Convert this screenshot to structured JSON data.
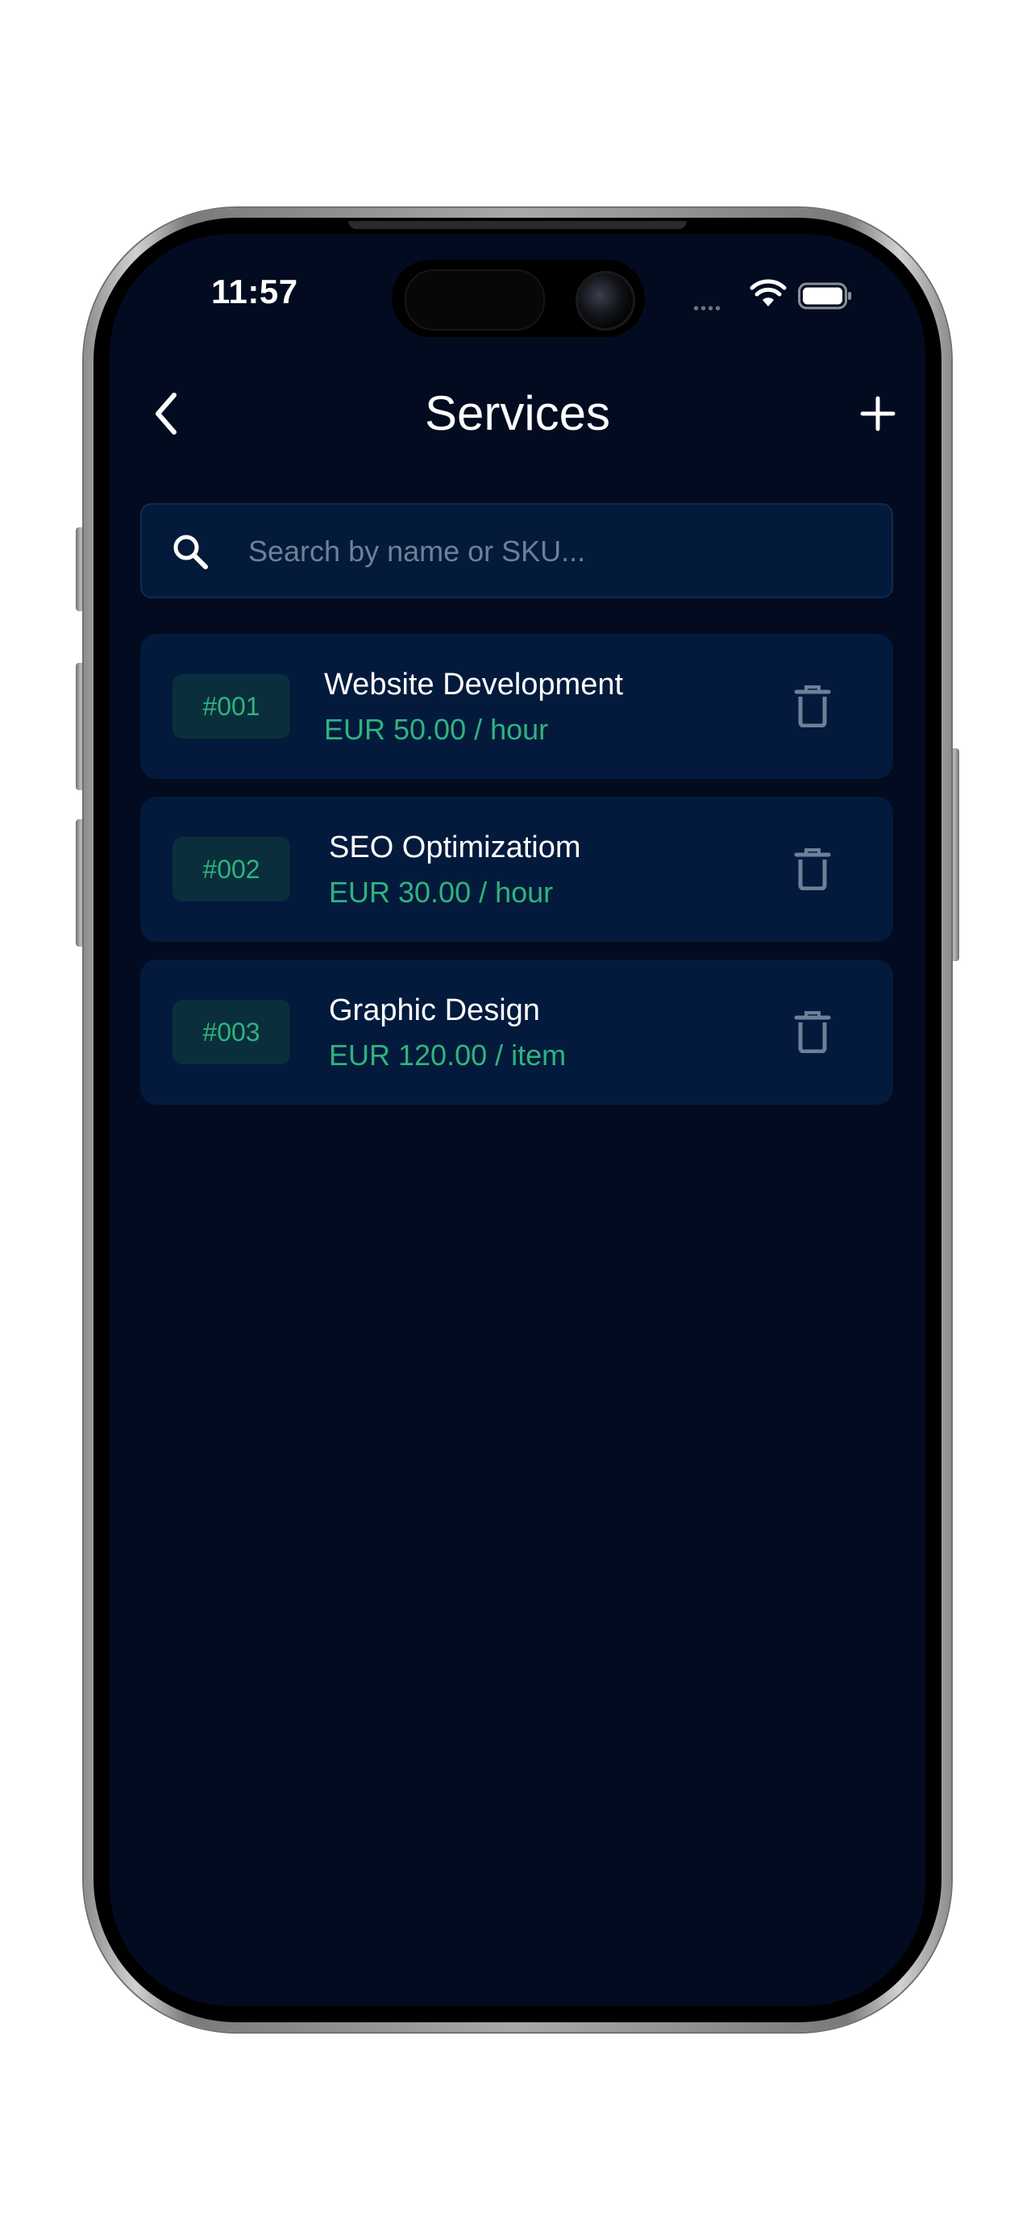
{
  "status_bar": {
    "time": "11:57",
    "dots": "••••",
    "icons": [
      "wifi-icon",
      "battery-icon"
    ]
  },
  "header": {
    "title": "Services",
    "back_icon": "chevron-left-icon",
    "add_icon": "plus-icon"
  },
  "search": {
    "placeholder": "Search by name or SKU...",
    "value": "",
    "icon": "search-icon"
  },
  "services": [
    {
      "sku": "#001",
      "name": "Website Development",
      "price": "EUR 50.00 / hour"
    },
    {
      "sku": "#002",
      "name": "SEO Optimizatiom",
      "price": "EUR 30.00 / hour"
    },
    {
      "sku": "#003",
      "name": "Graphic Design",
      "price": "EUR 120.00 / item"
    }
  ],
  "colors": {
    "background": "#020b1f",
    "card": "#031a3c",
    "accent_green": "#2fb37e",
    "muted_icon": "#6f7f98"
  }
}
